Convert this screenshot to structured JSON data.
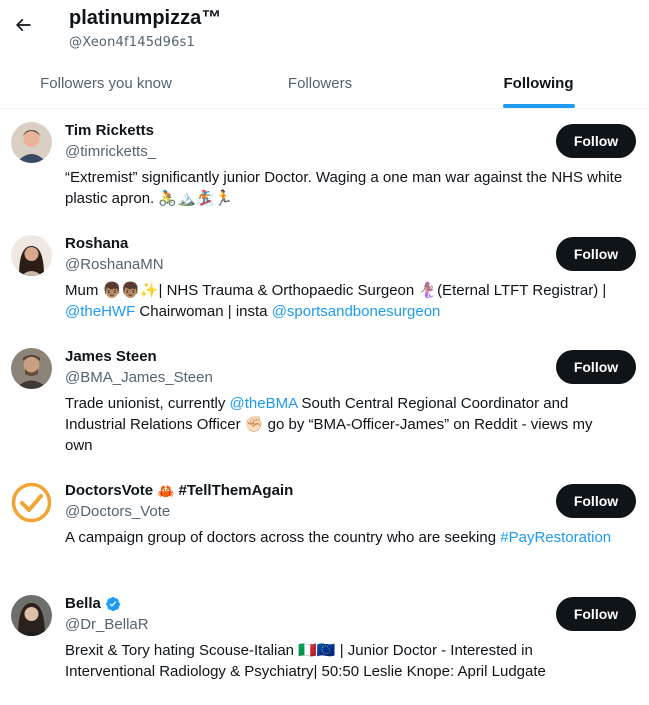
{
  "header": {
    "title": "platinumpizza™",
    "handle": "@Xeon4f145d96s1"
  },
  "tabs": [
    {
      "label": "Followers you know",
      "active": false
    },
    {
      "label": "Followers",
      "active": false
    },
    {
      "label": "Following",
      "active": true
    }
  ],
  "colors": {
    "accent": "#1d9bf0",
    "button_bg": "#0f1419",
    "secondary_text": "#536471"
  },
  "users": [
    {
      "name": "Tim Ricketts",
      "handle": "@timricketts_",
      "button": "Follow",
      "bio": [
        "“Extremist” significantly junior Doctor. Waging a one man war against the NHS white plastic apron. 🚴🏔️🏂🏃"
      ]
    },
    {
      "name": "Roshana",
      "handle": "@RoshanaMN",
      "button": "Follow",
      "bio_prefix": "Mum 👦🏽👦🏽✨| NHS Trauma & Orthopaedic Surgeon 🧜🏽‍♀️(Eternal LTFT Registrar) |",
      "link1": "@theHWF",
      "bio_mid": "Chairwoman | insta",
      "link2": "@sportsandbonesurgeon"
    },
    {
      "name": "James Steen",
      "handle": "@BMA_James_Steen",
      "button": "Follow",
      "bio_prefix": "Trade unionist, currently",
      "link1": "@theBMA",
      "bio_suffix": "South Central Regional Coordinator and Industrial Relations Officer ✊🏻 go by “BMA-Officer-James” on Reddit - views my own"
    },
    {
      "name": "DoctorsVote",
      "name_suffix": "#TellThemAgain",
      "crab": "🦀",
      "handle": "@Doctors_Vote",
      "button": "Follow",
      "bio_prefix": "A campaign group of doctors across the country who are seeking",
      "link1": "#PayRestoration"
    },
    {
      "name": "Bella",
      "verified": true,
      "handle": "@Dr_BellaR",
      "button": "Follow",
      "bio_prefix": "Brexit & Tory hating Scouse-Italian 🇮🇹🇪🇺 | Junior Doctor - Interested in Interventional Radiology & Psychiatry| 50:50 Leslie Knope: April Ludgate"
    }
  ]
}
